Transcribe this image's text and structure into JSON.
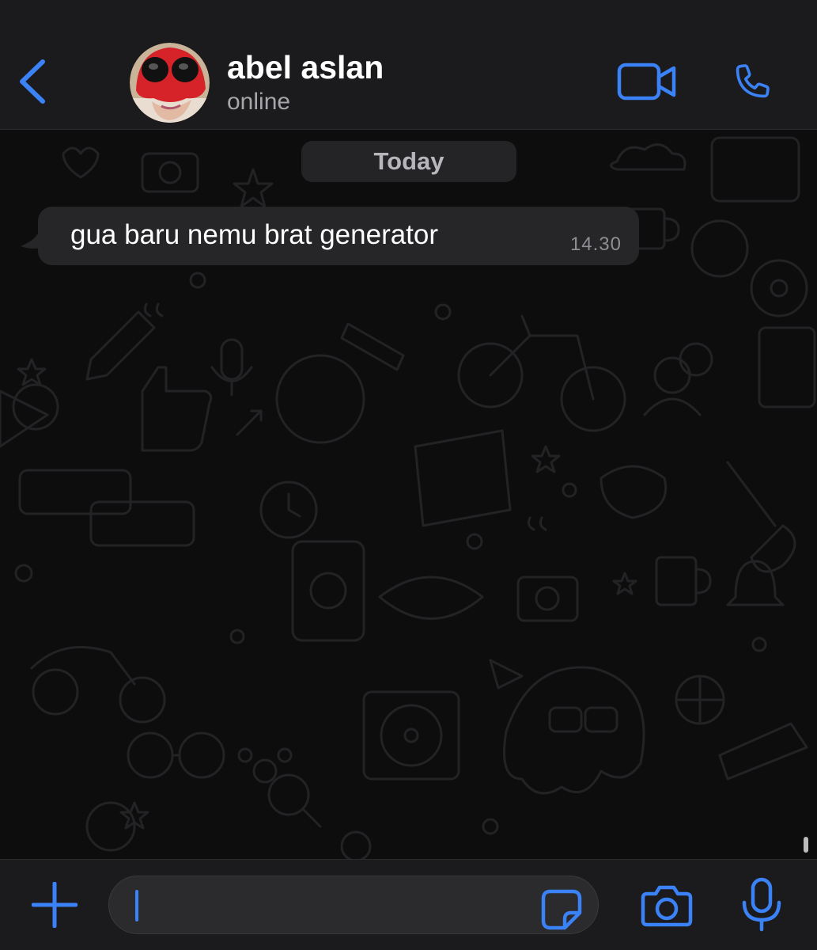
{
  "header": {
    "contact_name": "abel aslan",
    "status": "online",
    "icons": {
      "back": "chevron-left-icon",
      "avatar": "avatar",
      "video": "video-camera-icon",
      "call": "phone-icon"
    }
  },
  "chat": {
    "date_label": "Today",
    "messages": [
      {
        "text": "gua baru nemu brat generator",
        "time": "14.30",
        "direction": "incoming"
      }
    ]
  },
  "composer": {
    "input_value": "",
    "icons": {
      "attach": "plus-icon",
      "sticker": "sticker-icon",
      "camera": "camera-icon",
      "mic": "microphone-icon"
    }
  },
  "colors": {
    "accent": "#3b82f6",
    "header_bg": "#1b1b1d",
    "chat_bg": "#0d0d0e",
    "bubble_bg": "#262628",
    "text_primary": "#ffffff",
    "text_secondary": "#a6a6aa"
  }
}
